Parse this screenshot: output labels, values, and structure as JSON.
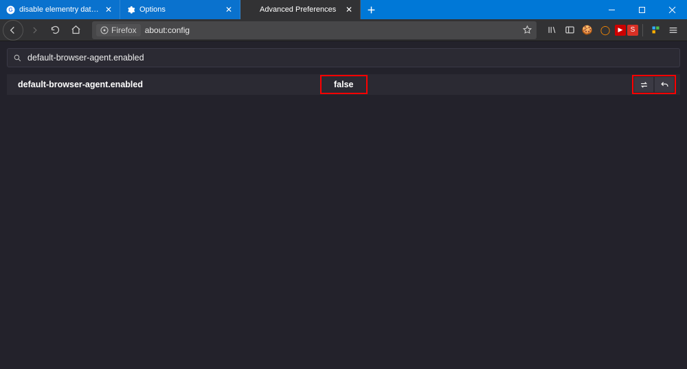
{
  "tabs": [
    {
      "label": "disable elementry data in firefox",
      "favicon": "google"
    },
    {
      "label": "Options",
      "favicon": "gear"
    },
    {
      "label": "Advanced Preferences",
      "favicon": "none",
      "active": true
    }
  ],
  "url": {
    "identity_label": "Firefox",
    "address": "about:config"
  },
  "config": {
    "search_value": "default-browser-agent.enabled",
    "pref_name": "default-browser-agent.enabled",
    "pref_value": "false"
  }
}
